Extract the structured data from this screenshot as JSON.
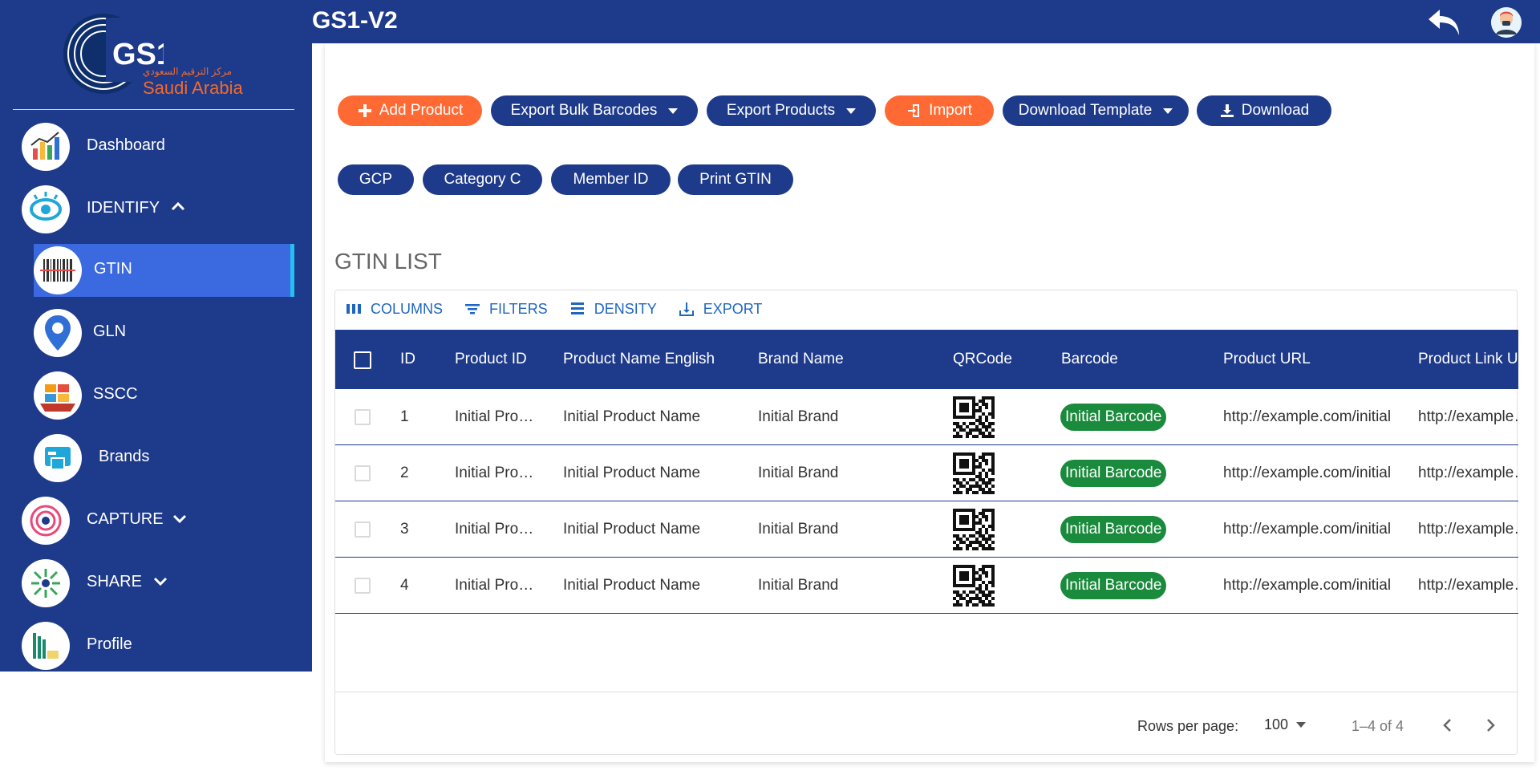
{
  "app": {
    "title": "GS1-V2"
  },
  "logo": {
    "brand": "GS1",
    "name_en": "Saudi Arabia",
    "name_ar": "مركز الترقيم السعودي"
  },
  "sidebar": {
    "items": [
      {
        "label": "Dashboard",
        "icon": "dashboard-chart-icon"
      },
      {
        "label": "IDENTIFY",
        "icon": "eye-icon",
        "expanded": true
      },
      {
        "label": "GTIN",
        "icon": "barcode-icon",
        "active": true
      },
      {
        "label": "GLN",
        "icon": "location-pin-icon"
      },
      {
        "label": "SSCC",
        "icon": "shipping-container-icon"
      },
      {
        "label": "Brands",
        "icon": "brand-tag-icon"
      },
      {
        "label": "CAPTURE",
        "icon": "target-icon",
        "expanded": false
      },
      {
        "label": "SHARE",
        "icon": "share-arrows-icon",
        "expanded": false
      },
      {
        "label": "Profile",
        "icon": "profile-building-icon"
      }
    ]
  },
  "actions": {
    "add_product": "Add Product",
    "export_bulk_barcodes": "Export Bulk Barcodes",
    "export_products": "Export Products",
    "import": "Import",
    "download_template": "Download Template",
    "download": "Download"
  },
  "filters": {
    "gcp": "GCP",
    "category_c": "Category C",
    "member_id": "Member ID",
    "print_gtin": "Print GTIN"
  },
  "gtin_list": {
    "title": "GTIN LIST",
    "toolbar": {
      "columns": "COLUMNS",
      "filters": "FILTERS",
      "density": "DENSITY",
      "export": "EXPORT"
    },
    "columns": [
      "ID",
      "Product ID",
      "Product Name English",
      "Brand Name",
      "QRCode",
      "Barcode",
      "Product URL",
      "Product Link U"
    ],
    "rows": [
      {
        "id": "1",
        "product_id": "Initial Pro…",
        "product_name": "Initial Product Name",
        "brand": "Initial Brand",
        "barcode": "Initial Barcode",
        "product_url": "http://example.com/initial",
        "product_link": "http://example…"
      },
      {
        "id": "2",
        "product_id": "Initial Pro…",
        "product_name": "Initial Product Name",
        "brand": "Initial Brand",
        "barcode": "Initial Barcode",
        "product_url": "http://example.com/initial",
        "product_link": "http://example…"
      },
      {
        "id": "3",
        "product_id": "Initial Pro…",
        "product_name": "Initial Product Name",
        "brand": "Initial Brand",
        "barcode": "Initial Barcode",
        "product_url": "http://example.com/initial",
        "product_link": "http://example…"
      },
      {
        "id": "4",
        "product_id": "Initial Pro…",
        "product_name": "Initial Product Name",
        "brand": "Initial Brand",
        "barcode": "Initial Barcode",
        "product_url": "http://example.com/initial",
        "product_link": "http://example…"
      }
    ],
    "footer": {
      "rows_per_page_label": "Rows per page:",
      "rows_per_page_value": "100",
      "pagination": "1–4 of 4"
    }
  },
  "colors": {
    "primary": "#1e3a8a",
    "active_item": "#3b6ae0",
    "active_bar": "#25c0f2",
    "accent_orange": "#ff6a34",
    "badge_green": "#1a8a3c",
    "toolbar_blue": "#1e66c1"
  }
}
